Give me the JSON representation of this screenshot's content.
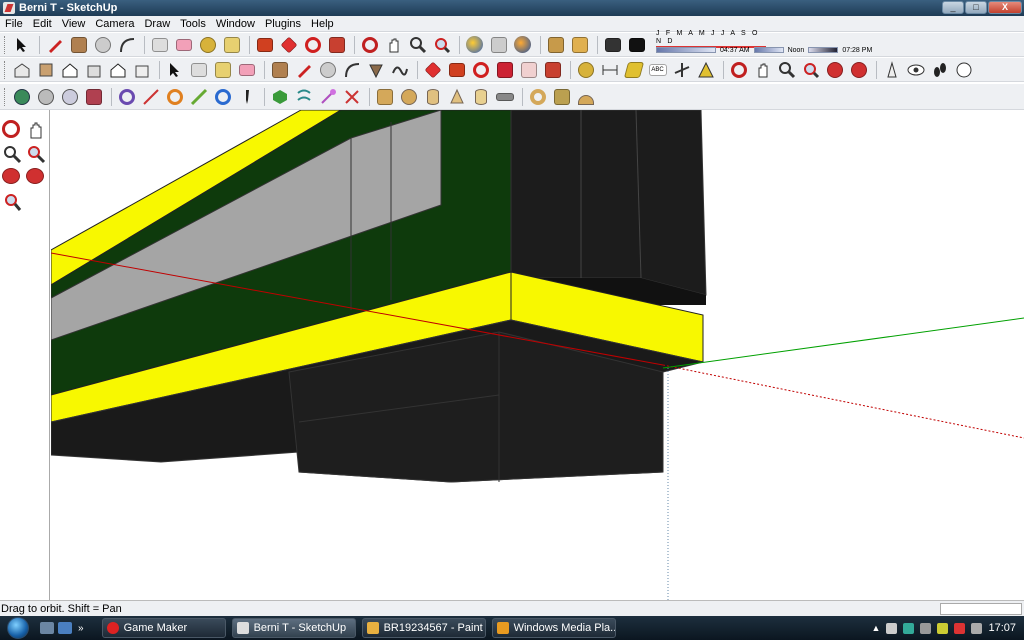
{
  "window": {
    "title": "Berni T - SketchUp",
    "controls": {
      "minimize": "_",
      "maximize": "□",
      "close": "X"
    }
  },
  "menu": [
    "File",
    "Edit",
    "View",
    "Camera",
    "Draw",
    "Tools",
    "Window",
    "Plugins",
    "Help"
  ],
  "shadow_settings": {
    "months": "J F M A M J J A S O N D",
    "time": "04:37 AM",
    "noon": "Noon",
    "end_time": "07:28 PM"
  },
  "status": {
    "hint": "Drag to orbit.  Shift = Pan",
    "measurements_value": ""
  },
  "taskbar": {
    "quick_launch_more": "»",
    "tasks": [
      {
        "label": "Game Maker",
        "active": false
      },
      {
        "label": "Berni T - SketchUp",
        "active": true
      },
      {
        "label": "BR19234567 - Paint",
        "active": false
      },
      {
        "label": "Windows Media Pla...",
        "active": false
      }
    ],
    "clock": "17:07"
  },
  "scene": {
    "colors": {
      "yellow": "#f8f800",
      "dark_green": "#0e3a0c",
      "grey": "#a0a0a0",
      "black": "#1a1a1a",
      "red_axis": "#c00000",
      "green_axis": "#00a000"
    }
  }
}
